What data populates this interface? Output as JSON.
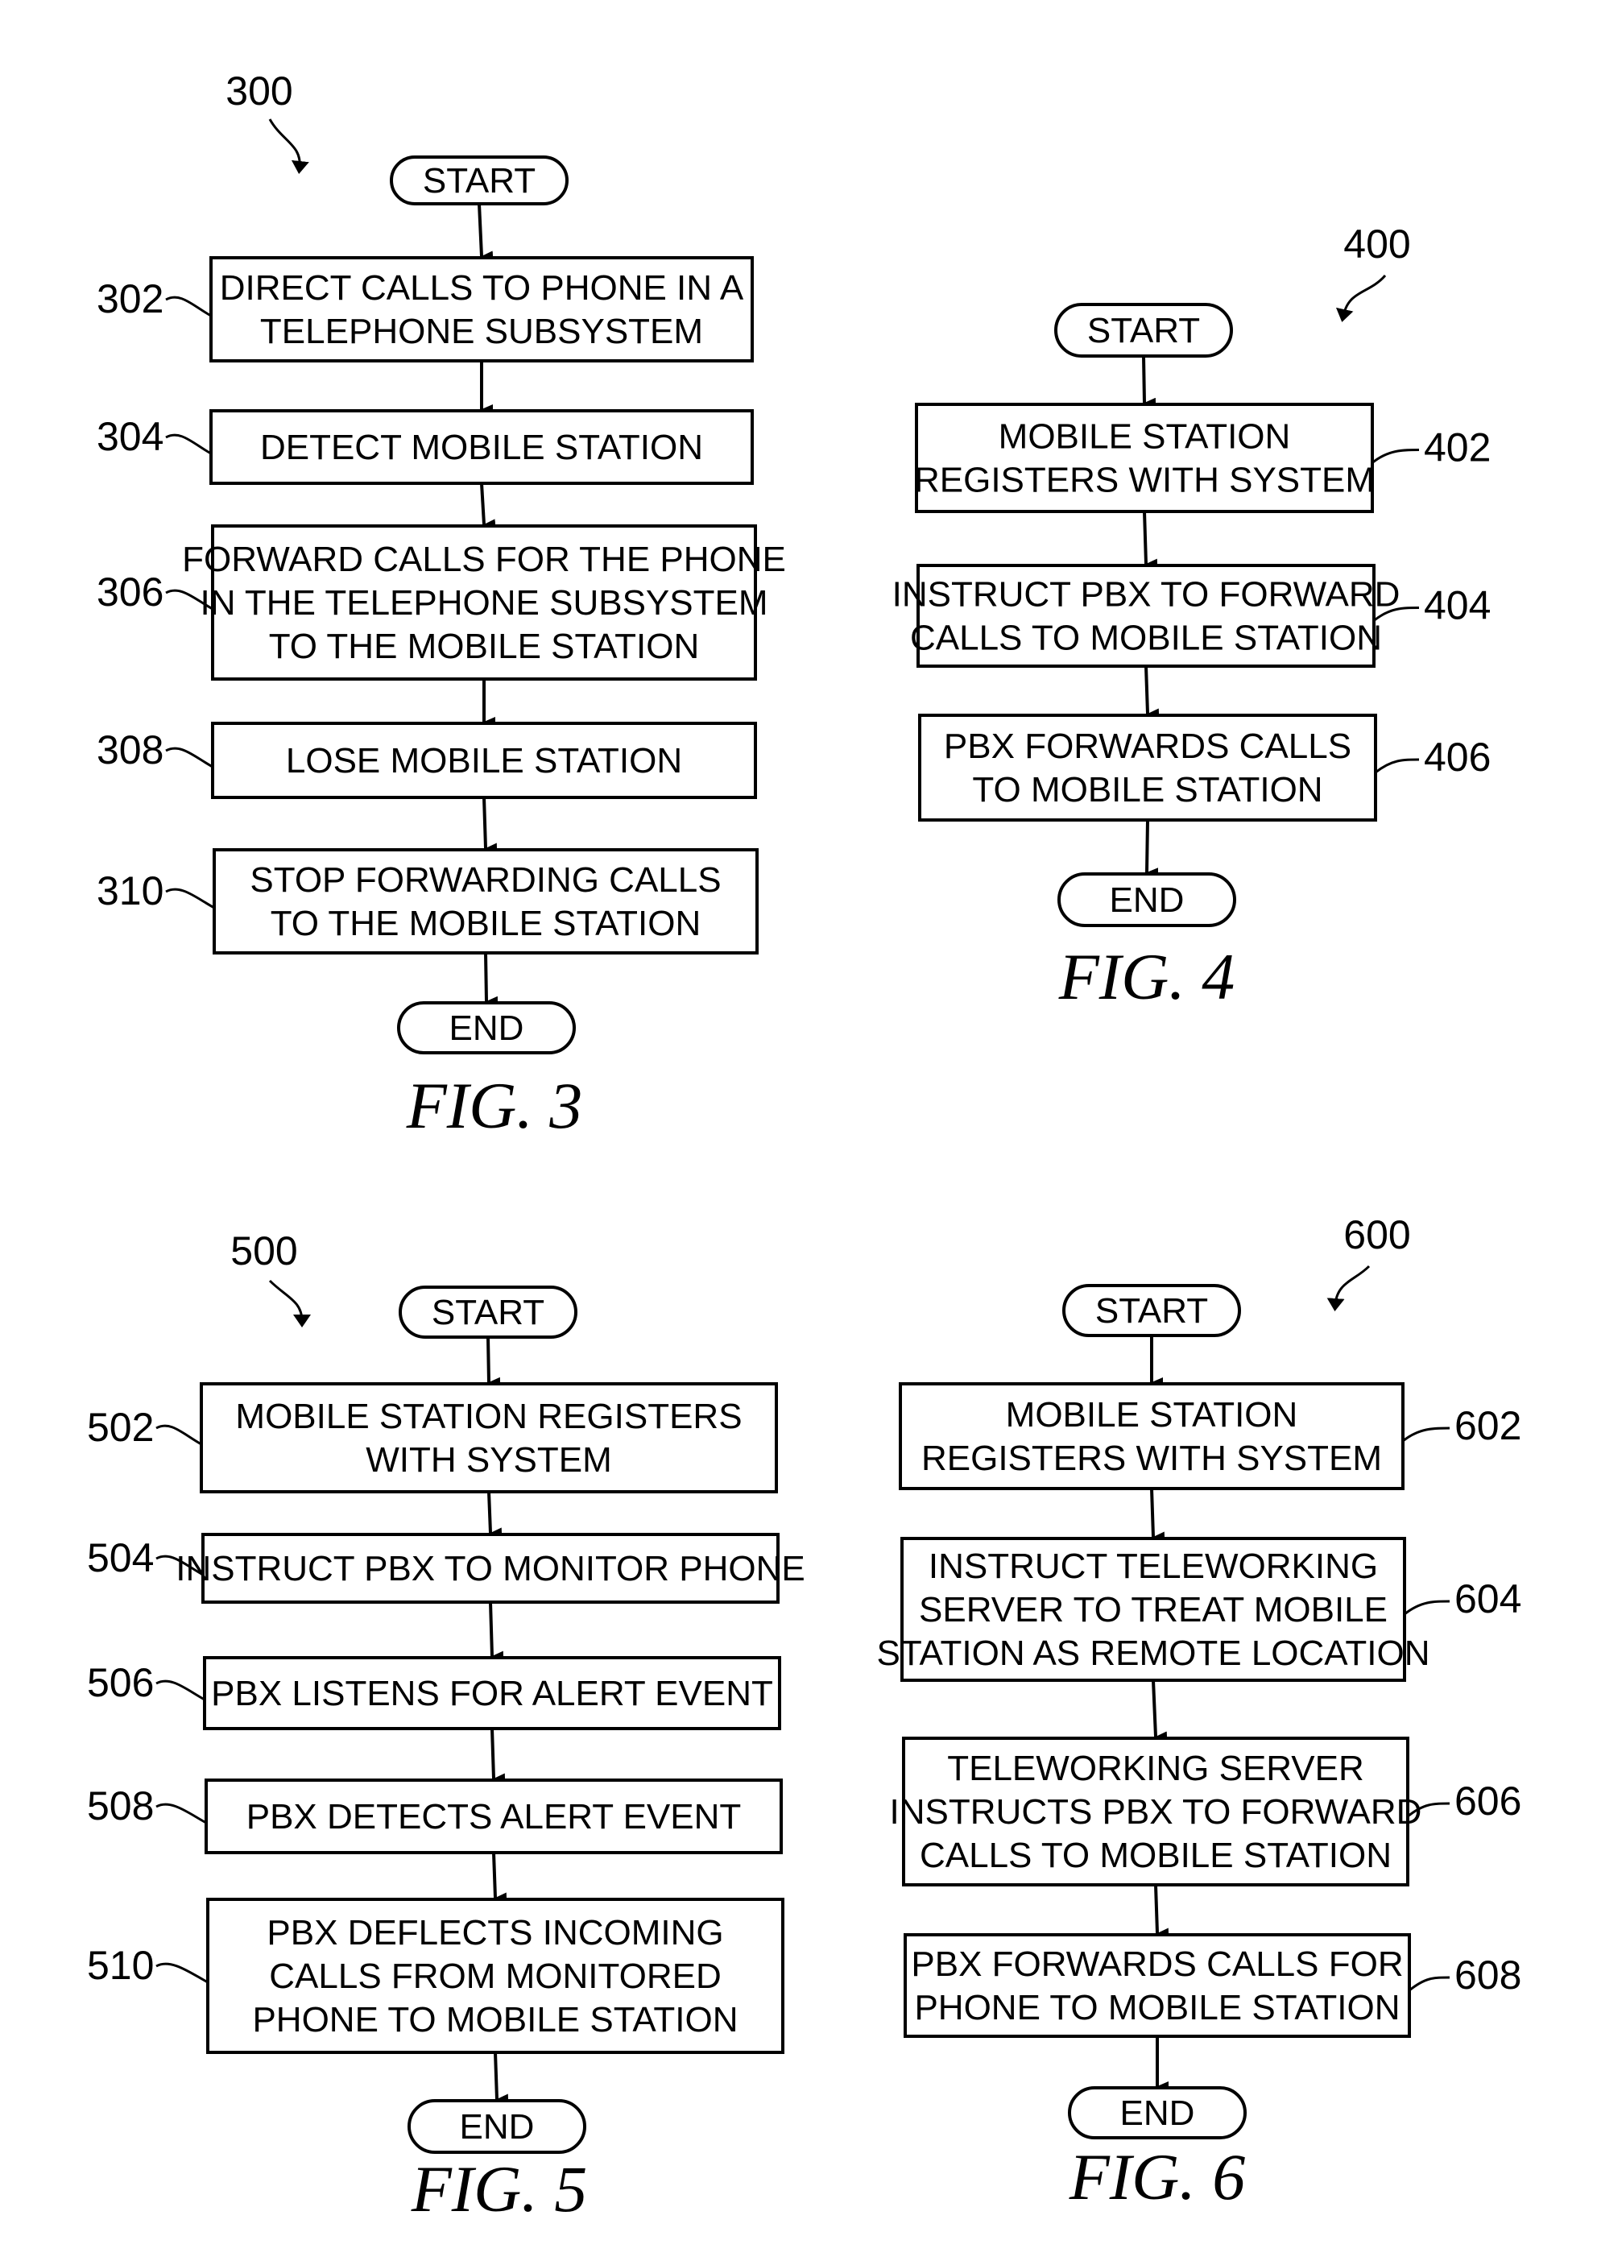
{
  "figures": [
    {
      "id": "fig3",
      "ref": "300",
      "caption": "FIG.  3",
      "start": "START",
      "end": "END",
      "steps": [
        {
          "ref": "302",
          "lines": [
            "DIRECT CALLS TO PHONE IN A",
            "TELEPHONE SUBSYSTEM"
          ]
        },
        {
          "ref": "304",
          "lines": [
            "DETECT MOBILE STATION"
          ]
        },
        {
          "ref": "306",
          "lines": [
            "FORWARD CALLS FOR THE PHONE",
            "IN THE TELEPHONE SUBSYSTEM",
            "TO THE MOBILE STATION"
          ]
        },
        {
          "ref": "308",
          "lines": [
            "LOSE MOBILE STATION"
          ]
        },
        {
          "ref": "310",
          "lines": [
            "STOP FORWARDING CALLS",
            "TO THE MOBILE STATION"
          ]
        }
      ]
    },
    {
      "id": "fig4",
      "ref": "400",
      "caption": "FIG.  4",
      "start": "START",
      "end": "END",
      "steps": [
        {
          "ref": "402",
          "lines": [
            "MOBILE STATION",
            "REGISTERS WITH SYSTEM"
          ]
        },
        {
          "ref": "404",
          "lines": [
            "INSTRUCT PBX TO FORWARD",
            "CALLS TO MOBILE STATION"
          ]
        },
        {
          "ref": "406",
          "lines": [
            "PBX FORWARDS CALLS",
            "TO MOBILE STATION"
          ]
        }
      ]
    },
    {
      "id": "fig5",
      "ref": "500",
      "caption": "FIG.  5",
      "start": "START",
      "end": "END",
      "steps": [
        {
          "ref": "502",
          "lines": [
            "MOBILE STATION REGISTERS",
            "WITH SYSTEM"
          ]
        },
        {
          "ref": "504",
          "lines": [
            "INSTRUCT PBX TO MONITOR PHONE"
          ]
        },
        {
          "ref": "506",
          "lines": [
            "PBX LISTENS FOR ALERT EVENT"
          ]
        },
        {
          "ref": "508",
          "lines": [
            "PBX DETECTS ALERT EVENT"
          ]
        },
        {
          "ref": "510",
          "lines": [
            "PBX DEFLECTS INCOMING",
            "CALLS FROM MONITORED",
            "PHONE TO MOBILE STATION"
          ]
        }
      ]
    },
    {
      "id": "fig6",
      "ref": "600",
      "caption": "FIG.  6",
      "start": "START",
      "end": "END",
      "steps": [
        {
          "ref": "602",
          "lines": [
            "MOBILE STATION",
            "REGISTERS WITH SYSTEM"
          ]
        },
        {
          "ref": "604",
          "lines": [
            "INSTRUCT TELEWORKING",
            "SERVER TO TREAT MOBILE",
            "STATION AS REMOTE LOCATION"
          ]
        },
        {
          "ref": "606",
          "lines": [
            "TELEWORKING SERVER",
            "INSTRUCTS PBX TO FORWARD",
            "CALLS TO MOBILE STATION"
          ]
        },
        {
          "ref": "608",
          "lines": [
            "PBX FORWARDS CALLS FOR",
            "PHONE TO MOBILE STATION"
          ]
        }
      ]
    }
  ]
}
